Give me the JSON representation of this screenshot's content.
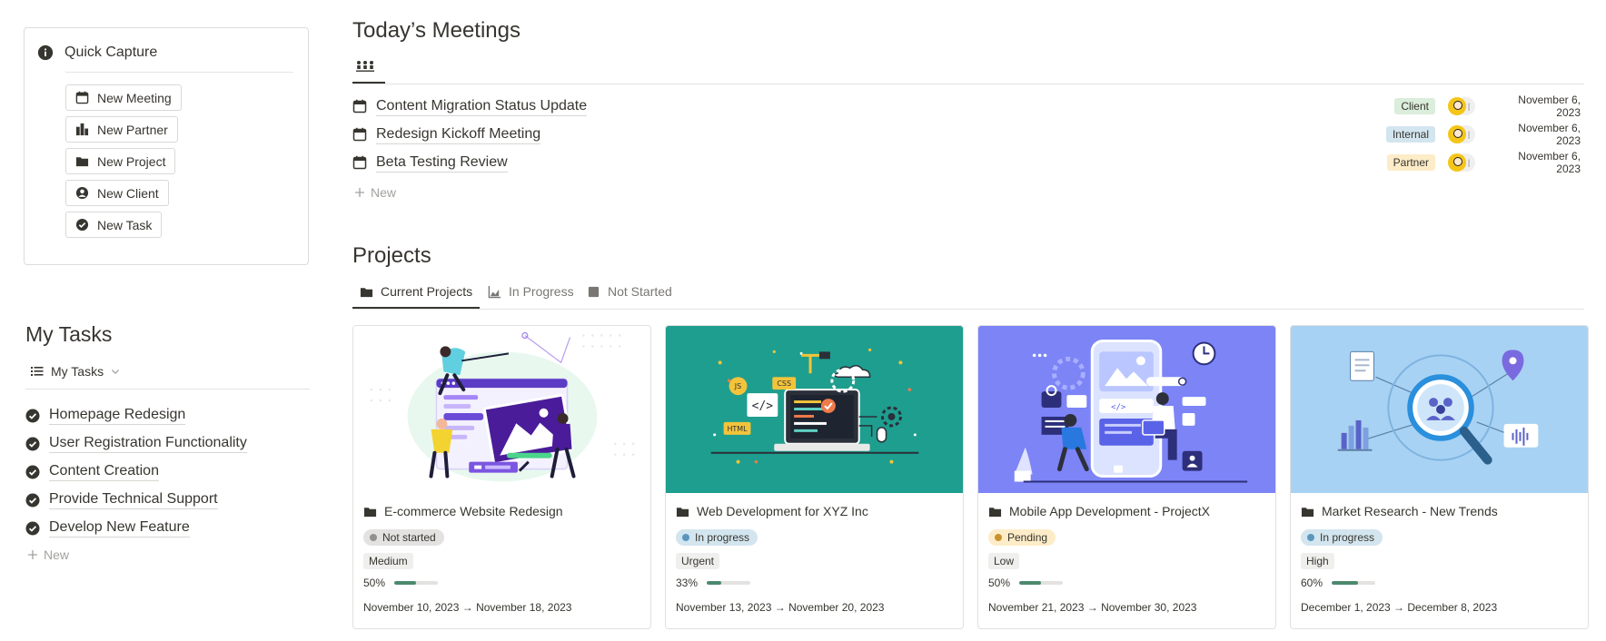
{
  "quick_capture": {
    "title": "Quick Capture",
    "buttons": [
      {
        "label": "New Meeting",
        "icon": "calendar-icon"
      },
      {
        "label": "New Partner",
        "icon": "building-icon"
      },
      {
        "label": "New Project",
        "icon": "folder-icon"
      },
      {
        "label": "New Client",
        "icon": "user-circle-icon"
      },
      {
        "label": "New Task",
        "icon": "check-circle-icon"
      }
    ]
  },
  "my_tasks": {
    "title": "My Tasks",
    "view_label": "My Tasks",
    "items": [
      "Homepage Redesign",
      "User Registration Functionality",
      "Content Creation",
      "Provide Technical Support",
      "Develop New Feature"
    ],
    "new_label": "New"
  },
  "meetings": {
    "title": "Today’s Meetings",
    "view_icon": "people-icon",
    "rows": [
      {
        "title": "Content Migration Status Update",
        "tag": "Client",
        "tag_color": "#dbeddb",
        "date": "November 6, 2023"
      },
      {
        "title": "Redesign Kickoff Meeting",
        "tag": "Internal",
        "tag_color": "#d3e5ef",
        "date": "November 6, 2023"
      },
      {
        "title": "Beta Testing Review",
        "tag": "Partner",
        "tag_color": "#fdecc8",
        "date": "November 6, 2023"
      }
    ],
    "new_label": "New"
  },
  "projects": {
    "title": "Projects",
    "tabs": [
      {
        "label": "Current Projects",
        "icon": "folder-icon",
        "active": true
      },
      {
        "label": "In Progress",
        "icon": "area-chart-icon",
        "active": false
      },
      {
        "label": "Not Started",
        "icon": "square-icon",
        "active": false
      }
    ],
    "cards": [
      {
        "title": "E-commerce Website Redesign",
        "status": "Not started",
        "status_bg": "#e3e2e0",
        "status_dot": "#91918e",
        "priority": "Medium",
        "progress_label": "50%",
        "progress": 0.5,
        "dates": "November 10, 2023 → November 18, 2023",
        "cover_bg": "#ffffff"
      },
      {
        "title": "Web Development for XYZ Inc",
        "status": "In progress",
        "status_bg": "#d3e5ef",
        "status_dot": "#5b97bd",
        "priority": "Urgent",
        "progress_label": "33%",
        "progress": 0.33,
        "dates": "November 13, 2023 → November 20, 2023",
        "cover_bg": "#1e9e8e"
      },
      {
        "title": "Mobile App Development - ProjectX",
        "status": "Pending",
        "status_bg": "#fdecc8",
        "status_dot": "#cb912f",
        "priority": "Low",
        "progress_label": "50%",
        "progress": 0.5,
        "dates": "November 21, 2023 → November 30, 2023",
        "cover_bg": "#7c84f6"
      },
      {
        "title": "Market Research - New Trends",
        "status": "In progress",
        "status_bg": "#d3e5ef",
        "status_dot": "#5b97bd",
        "priority": "High",
        "progress_label": "60%",
        "progress": 0.6,
        "dates": "December 1, 2023 → December 8, 2023",
        "cover_bg": "#a8d2f3"
      }
    ]
  },
  "colors": {
    "text": "#37352f",
    "muted": "#787774",
    "progress_fill": "#4b8a6e"
  }
}
